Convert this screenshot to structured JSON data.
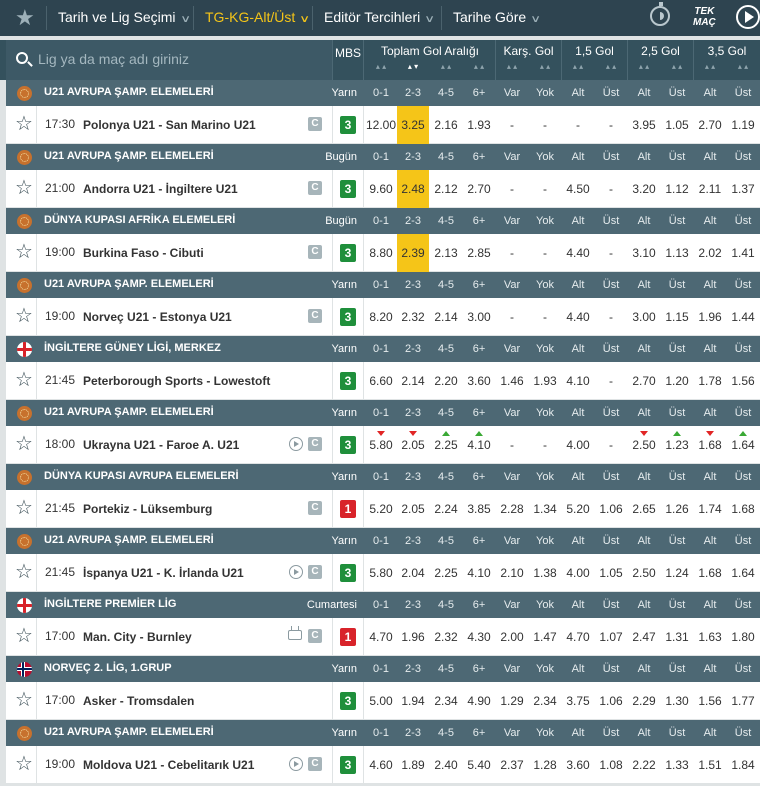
{
  "topbar": {
    "menus": [
      "Tarih ve Lig Seçimi",
      "TG-KG-Alt/Üst",
      "Editör Tercihleri",
      "Tarihe Göre"
    ],
    "tek_mac_line1": "TEK",
    "tek_mac_line2": "MAÇ"
  },
  "search": {
    "placeholder": "Lig ya da maç adı giriniz"
  },
  "columns": {
    "mbs": "MBS",
    "groups": [
      "Toplam Gol Aralığı",
      "Karş. Gol",
      "1,5 Gol",
      "2,5 Gol",
      "3,5 Gol"
    ],
    "subheaders": [
      "0-1",
      "2-3",
      "4-5",
      "6+",
      "Var",
      "Yok",
      "Alt",
      "Üst",
      "Alt",
      "Üst",
      "Alt",
      "Üst"
    ]
  },
  "colors": {
    "mbs_green": "#1f8f3b",
    "mbs_red": "#d8232a",
    "highlight": "#f5c518"
  },
  "blocks": [
    {
      "league": "U21 AVRUPA ŞAMP. ELEMELERİ",
      "flag": "eu-icon",
      "day": "Yarın",
      "match": {
        "time": "17:30",
        "teams": "Polonya U21 - San Marino U21",
        "icons": [
          "c"
        ],
        "mbs": "3",
        "odds": [
          "12.00",
          "3.25",
          "2.16",
          "1.93",
          "-",
          "-",
          "-",
          "-",
          "3.95",
          "1.05",
          "2.70",
          "1.19"
        ],
        "hl": [
          1
        ],
        "arrows": {}
      }
    },
    {
      "league": "U21 AVRUPA ŞAMP. ELEMELERİ",
      "flag": "eu-icon",
      "day": "Bugün",
      "match": {
        "time": "21:00",
        "teams": "Andorra U21 - İngiltere U21",
        "icons": [
          "c"
        ],
        "mbs": "3",
        "odds": [
          "9.60",
          "2.48",
          "2.12",
          "2.70",
          "-",
          "-",
          "4.50",
          "-",
          "3.20",
          "1.12",
          "2.11",
          "1.37"
        ],
        "hl": [
          1
        ],
        "arrows": {}
      }
    },
    {
      "league": "DÜNYA KUPASI AFRİKA ELEMELERİ",
      "flag": "world-icon",
      "day": "Bugün",
      "match": {
        "time": "19:00",
        "teams": "Burkina Faso - Cibuti",
        "icons": [
          "c"
        ],
        "mbs": "3",
        "odds": [
          "8.80",
          "2.39",
          "2.13",
          "2.85",
          "-",
          "-",
          "4.40",
          "-",
          "3.10",
          "1.13",
          "2.02",
          "1.41"
        ],
        "hl": [
          1
        ],
        "arrows": {}
      }
    },
    {
      "league": "U21 AVRUPA ŞAMP. ELEMELERİ",
      "flag": "eu-icon",
      "day": "Yarın",
      "match": {
        "time": "19:00",
        "teams": "Norveç U21 - Estonya U21",
        "icons": [
          "c"
        ],
        "mbs": "3",
        "odds": [
          "8.20",
          "2.32",
          "2.14",
          "3.00",
          "-",
          "-",
          "4.40",
          "-",
          "3.00",
          "1.15",
          "1.96",
          "1.44"
        ],
        "hl": [],
        "arrows": {}
      }
    },
    {
      "league": "İNGİLTERE GÜNEY LİGİ, MERKEZ",
      "flag": "england-icon",
      "day": "Yarın",
      "match": {
        "time": "21:45",
        "teams": "Peterborough Sports - Lowestoft",
        "icons": [],
        "mbs": "3",
        "odds": [
          "6.60",
          "2.14",
          "2.20",
          "3.60",
          "1.46",
          "1.93",
          "4.10",
          "-",
          "2.70",
          "1.20",
          "1.78",
          "1.56"
        ],
        "hl": [],
        "arrows": {}
      }
    },
    {
      "league": "U21 AVRUPA ŞAMP. ELEMELERİ",
      "flag": "eu-icon",
      "day": "Yarın",
      "match": {
        "time": "18:00",
        "teams": "Ukrayna U21 - Faroe A. U21",
        "icons": [
          "play",
          "c"
        ],
        "mbs": "3",
        "odds": [
          "5.80",
          "2.05",
          "2.25",
          "4.10",
          "-",
          "-",
          "4.00",
          "-",
          "2.50",
          "1.23",
          "1.68",
          "1.64"
        ],
        "hl": [],
        "arrows": {
          "0": "down",
          "1": "down",
          "2": "up",
          "3": "up",
          "8": "down",
          "9": "up",
          "10": "down",
          "11": "up"
        }
      }
    },
    {
      "league": "DÜNYA KUPASI AVRUPA ELEMELERİ",
      "flag": "world-icon",
      "day": "Yarın",
      "match": {
        "time": "21:45",
        "teams": "Portekiz - Lüksemburg",
        "icons": [
          "c"
        ],
        "mbs": "1",
        "odds": [
          "5.20",
          "2.05",
          "2.24",
          "3.85",
          "2.28",
          "1.34",
          "5.20",
          "1.06",
          "2.65",
          "1.26",
          "1.74",
          "1.68"
        ],
        "hl": [],
        "arrows": {}
      }
    },
    {
      "league": "U21 AVRUPA ŞAMP. ELEMELERİ",
      "flag": "eu-icon",
      "day": "Yarın",
      "match": {
        "time": "21:45",
        "teams": "İspanya U21 - K. İrlanda U21",
        "icons": [
          "play",
          "c"
        ],
        "mbs": "3",
        "odds": [
          "5.80",
          "2.04",
          "2.25",
          "4.10",
          "2.10",
          "1.38",
          "4.00",
          "1.05",
          "2.50",
          "1.24",
          "1.68",
          "1.64"
        ],
        "hl": [],
        "arrows": {}
      }
    },
    {
      "league": "İNGİLTERE PREMİER LİG",
      "flag": "england-icon",
      "day": "Cumartesi",
      "match": {
        "time": "17:00",
        "teams": "Man. City - Burnley",
        "icons": [
          "tv",
          "c"
        ],
        "mbs": "1",
        "odds": [
          "4.70",
          "1.96",
          "2.32",
          "4.30",
          "2.00",
          "1.47",
          "4.70",
          "1.07",
          "2.47",
          "1.31",
          "1.63",
          "1.80"
        ],
        "hl": [],
        "arrows": {}
      }
    },
    {
      "league": "NORVEÇ 2. LİG, 1.GRUP",
      "flag": "norway-icon",
      "day": "Yarın",
      "match": {
        "time": "17:00",
        "teams": "Asker - Tromsdalen",
        "icons": [],
        "mbs": "3",
        "odds": [
          "5.00",
          "1.94",
          "2.34",
          "4.90",
          "1.29",
          "2.34",
          "3.75",
          "1.06",
          "2.29",
          "1.30",
          "1.56",
          "1.77"
        ],
        "hl": [],
        "arrows": {}
      }
    },
    {
      "league": "U21 AVRUPA ŞAMP. ELEMELERİ",
      "flag": "eu-icon",
      "day": "Yarın",
      "match": {
        "time": "19:00",
        "teams": "Moldova U21 - Cebelitarık U21",
        "icons": [
          "play",
          "c"
        ],
        "mbs": "3",
        "odds": [
          "4.60",
          "1.89",
          "2.40",
          "5.40",
          "2.37",
          "1.28",
          "3.60",
          "1.08",
          "2.22",
          "1.33",
          "1.51",
          "1.84"
        ],
        "hl": [],
        "arrows": {}
      }
    }
  ]
}
